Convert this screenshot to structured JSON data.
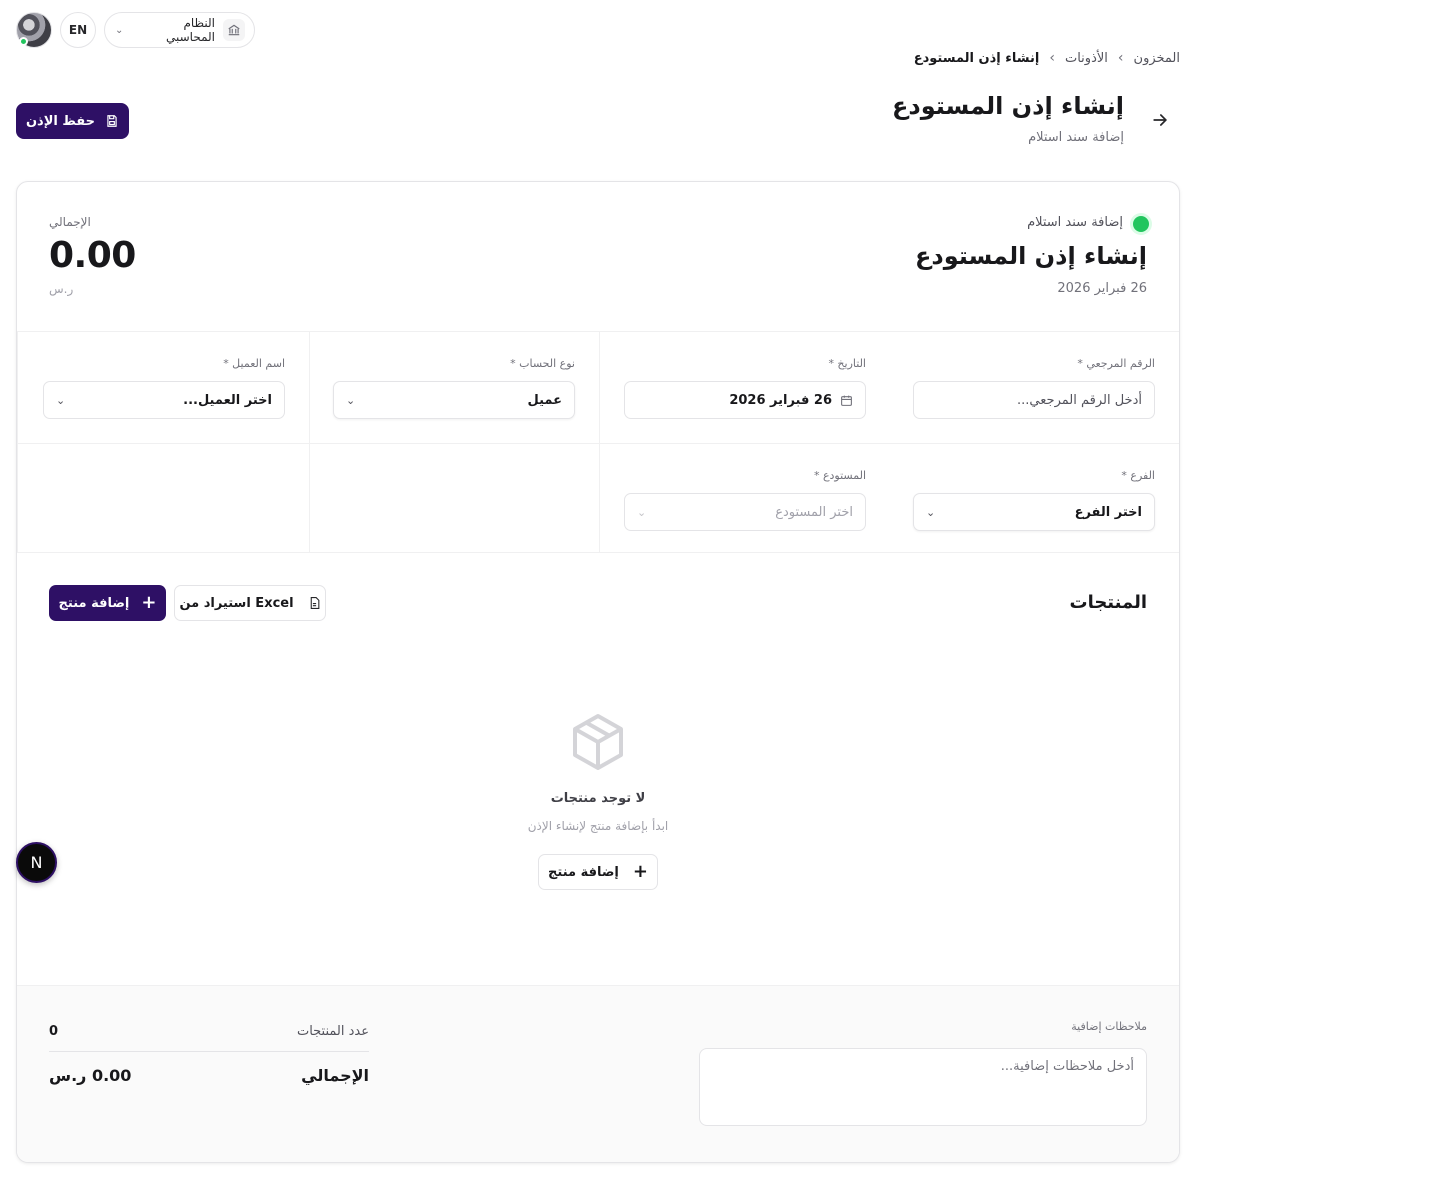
{
  "topbar": {
    "lang": "EN",
    "system_label": "النظام المحاسبي"
  },
  "breadcrumb": [
    "المخزون",
    "الأذونات",
    "إنشاء إذن المستودع"
  ],
  "header": {
    "title": "إنشاء إذن المستودع",
    "subtitle": "إضافة سند استلام",
    "save_label": "حفظ الإذن"
  },
  "card": {
    "status_label": "إضافة سند استلام",
    "title": "إنشاء إذن المستودع",
    "date": "26 فبراير 2026",
    "total_caption": "الإجمالي",
    "total_value": "0.00",
    "currency": "ر.س"
  },
  "form": {
    "reference": {
      "label": "الرقم المرجعي *",
      "placeholder": "أدخل الرقم المرجعي..."
    },
    "date": {
      "label": "التاريخ *",
      "value": "26 فبراير 2026"
    },
    "account_type": {
      "label": "نوع الحساب *",
      "value": "عميل"
    },
    "customer": {
      "label": "اسم العميل *",
      "value": "اختر العميل..."
    },
    "branch": {
      "label": "الفرع *",
      "value": "اختر الفرع"
    },
    "warehouse": {
      "label": "المستودع *",
      "value": "اختر المستودع"
    }
  },
  "products": {
    "title": "المنتجات",
    "add_label": "إضافة منتج",
    "import_label": "استيراد من Excel",
    "empty_title": "لا توجد منتجات",
    "empty_sub": "ابدأ بإضافة منتج لإنشاء الإذن",
    "empty_add_label": "إضافة منتج"
  },
  "footer": {
    "notes_label": "ملاحظات إضافية",
    "notes_placeholder": "أدخل ملاحظات إضافية...",
    "count_label": "عدد المنتجات",
    "count_value": "0",
    "total_label": "الإجمالي",
    "total_value": "0.00 ر.س"
  },
  "floating_button": "N",
  "colors": {
    "primary": "#2e1065",
    "status": "#22c55e"
  }
}
